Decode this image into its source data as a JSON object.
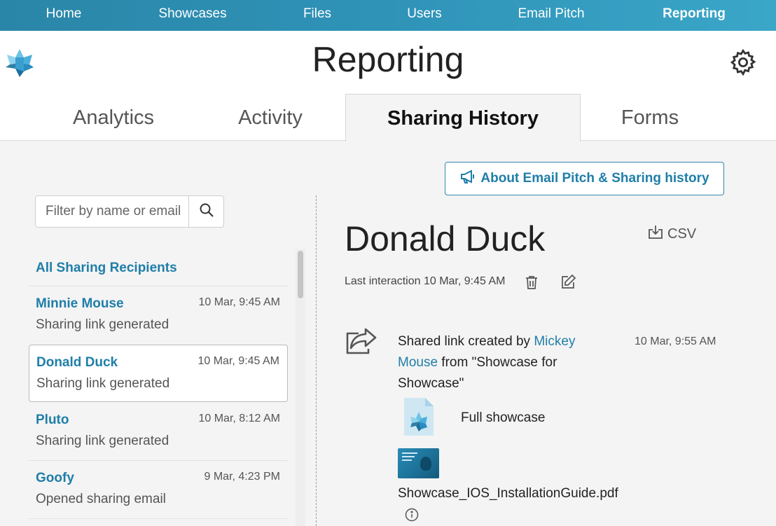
{
  "nav": {
    "items": [
      {
        "label": "Home",
        "active": false
      },
      {
        "label": "Showcases",
        "active": false
      },
      {
        "label": "Files",
        "active": false
      },
      {
        "label": "Users",
        "active": false
      },
      {
        "label": "Email Pitch",
        "active": false
      },
      {
        "label": "Reporting",
        "active": true
      }
    ]
  },
  "header": {
    "title": "Reporting",
    "logo_icon": "showcase-logo-icon",
    "settings_icon": "gear-icon"
  },
  "tabs": [
    {
      "label": "Analytics",
      "active": false
    },
    {
      "label": "Activity",
      "active": false
    },
    {
      "label": "Sharing History",
      "active": true
    },
    {
      "label": "Forms",
      "active": false
    }
  ],
  "about_button": {
    "label": "About Email Pitch & Sharing history",
    "icon": "megaphone-icon"
  },
  "filter": {
    "placeholder": "Filter by name or email",
    "value": "",
    "icon": "search-icon"
  },
  "recipients": {
    "all_label": "All Sharing Recipients",
    "items": [
      {
        "name": "Minnie Mouse",
        "time": "10 Mar, 9:45 AM",
        "status": "Sharing link generated",
        "selected": false
      },
      {
        "name": "Donald Duck",
        "time": "10 Mar, 9:45 AM",
        "status": "Sharing link generated",
        "selected": true
      },
      {
        "name": "Pluto",
        "time": "10 Mar, 8:12 AM",
        "status": "Sharing link generated",
        "selected": false
      },
      {
        "name": "Goofy",
        "time": "9 Mar, 4:23 PM",
        "status": "Opened sharing email",
        "selected": false
      }
    ]
  },
  "detail": {
    "name": "Donald Duck",
    "csv_label": "CSV",
    "last_interaction": "Last interaction 10 Mar, 9:45 AM",
    "event": {
      "prefix": "Shared link created by ",
      "user": "Mickey Mouse",
      "suffix": " from \"Showcase for Showcase\"",
      "time": "10 Mar, 9:55 AM",
      "items": [
        {
          "label": "Full showcase",
          "icon": "showcase-document-icon"
        },
        {
          "label": "Showcase_IOS_InstallationGuide.pdf",
          "icon": "pdf-thumbnail"
        }
      ]
    }
  },
  "colors": {
    "nav_bg": "#2f93b8",
    "accent": "#1f7ea8",
    "panel_bg": "#f4f4f4"
  }
}
